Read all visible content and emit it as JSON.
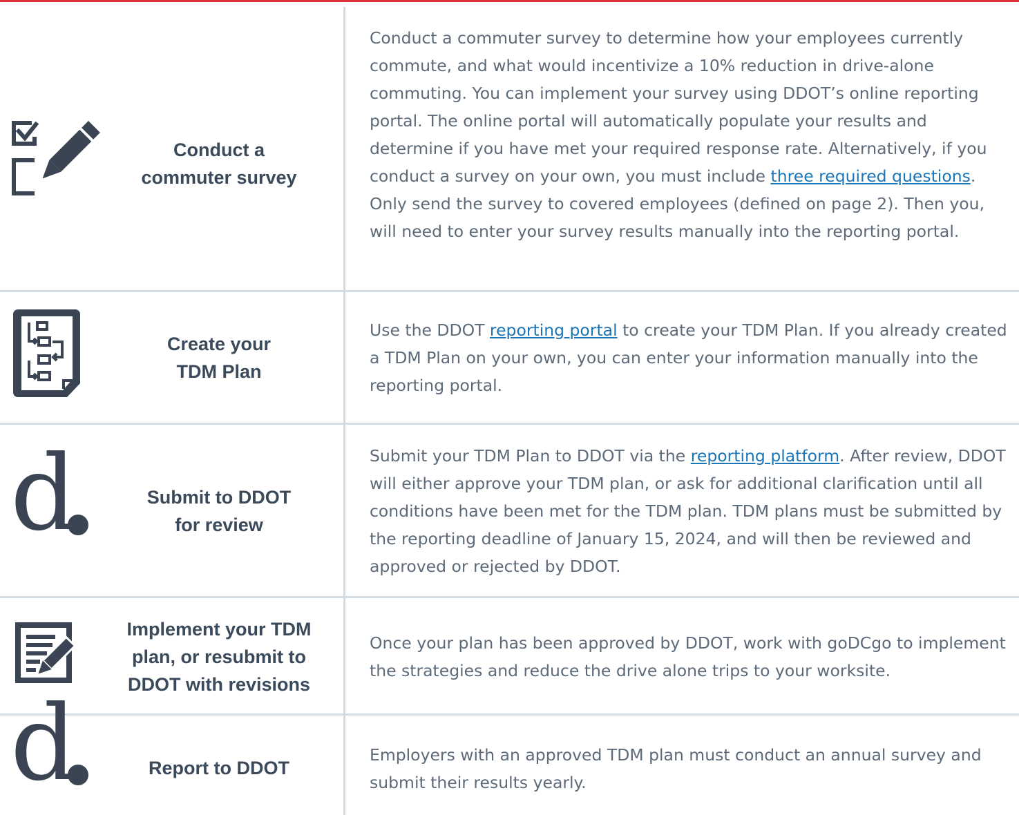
{
  "rows": [
    {
      "label": "Conduct a commuter survey",
      "label_lines": [
        "Conduct a",
        "commuter survey"
      ],
      "icon": "checklist-pencil-icon",
      "desc_before": "Conduct a commuter survey to determine how your employees currently commute, and what would incentivize a 10% reduction in drive-alone commuting. You can implement your survey using DDOT’s online reporting portal. The online portal will automatically populate your results and determine if you have met your required response rate. Alternatively, if you conduct a survey on your own, you must include ",
      "link": "three required questions",
      "desc_after": ". Only send the survey to covered employees (defined on page 2). Then you, will need to enter your survey results manually into the reporting portal."
    },
    {
      "label_lines": [
        "Create your",
        "TDM Plan"
      ],
      "icon": "plan-document-icon",
      "desc_before": "Use the DDOT ",
      "link": "reporting portal",
      "desc_after": " to create your TDM Plan. If you already created a TDM Plan on your own, you can enter your information manually into the reporting portal."
    },
    {
      "label_lines": [
        "Submit to DDOT",
        "for review"
      ],
      "icon": "ddot-logo-icon",
      "logo_letter": "d",
      "desc_before": "Submit your TDM Plan to DDOT via the ",
      "link": "reporting platform",
      "desc_after": ". After review, DDOT will either approve your TDM plan, or ask for additional clarification until all conditions have been met for the TDM plan. TDM plans must be submitted by the reporting deadline of January 15, 2024, and will then be reviewed and approved or rejected by DDOT."
    },
    {
      "label_lines": [
        "Implement your TDM",
        "plan, or resubmit to",
        "DDOT with revisions"
      ],
      "icon": "edit-document-icon",
      "desc": "Once your plan has been approved by DDOT, work with goDCgo to implement the strategies and reduce the drive alone trips to your worksite."
    },
    {
      "label_lines": [
        "Report to DDOT"
      ],
      "icon": "ddot-logo-icon",
      "logo_letter": "d",
      "desc": "Employers with an approved TDM plan must conduct an annual survey and submit their results yearly."
    }
  ],
  "colors": {
    "accent_top_rule": "#e0303a",
    "divider": "#d3dbe3",
    "label_text": "#3b4a5a",
    "body_text": "#5d6a79",
    "link": "#1b76b8",
    "icon": "#3a4452"
  }
}
